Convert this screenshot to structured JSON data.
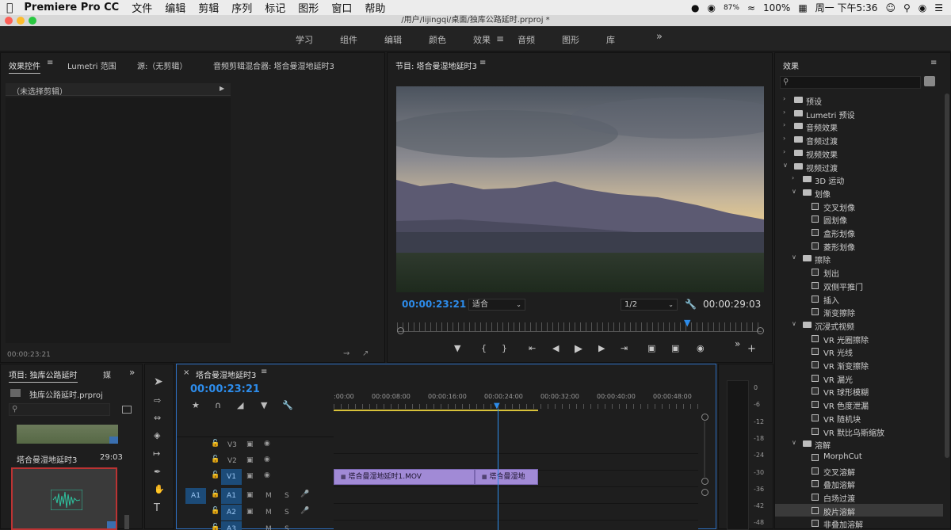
{
  "menubar": {
    "app": "Premiere Pro CC",
    "items": [
      "文件",
      "编辑",
      "剪辑",
      "序列",
      "标记",
      "图形",
      "窗口",
      "帮助"
    ],
    "battery_pct": "87%",
    "wifi_label": "100%",
    "clock": "周一 下午5:36"
  },
  "window": {
    "title": "/用户/lijingqi/桌面/独库公路延时.prproj *"
  },
  "workspaces": {
    "tabs": [
      "学习",
      "组件",
      "编辑",
      "颜色",
      "效果",
      "音频",
      "图形",
      "库"
    ],
    "active": "效果",
    "more": "»"
  },
  "effect_controls": {
    "tabs": [
      "效果控件",
      "Lumetri 范围",
      "源:（无剪辑）",
      "音频剪辑混合器: 塔合曼湿地延时3"
    ],
    "no_clip": "（未选择剪辑）",
    "timecode": "00:00:23:21"
  },
  "program": {
    "title": "节目: 塔合曼湿地延时3",
    "timecode": "00:00:23:21",
    "fit": "适合",
    "quality": "1/2",
    "duration": "00:00:29:03"
  },
  "effects_panel": {
    "title": "效果",
    "items": [
      {
        "label": "预设",
        "level": 0,
        "kind": "folder-star"
      },
      {
        "label": "Lumetri 预设",
        "level": 0,
        "kind": "folder-star"
      },
      {
        "label": "音频效果",
        "level": 0,
        "kind": "folder"
      },
      {
        "label": "音频过渡",
        "level": 0,
        "kind": "folder"
      },
      {
        "label": "视频效果",
        "level": 0,
        "kind": "folder"
      },
      {
        "label": "视频过渡",
        "level": 0,
        "kind": "folder-open"
      },
      {
        "label": "3D 运动",
        "level": 1,
        "kind": "folder"
      },
      {
        "label": "划像",
        "level": 1,
        "kind": "folder-open"
      },
      {
        "label": "交叉划像",
        "level": 2,
        "kind": "fx"
      },
      {
        "label": "圆划像",
        "level": 2,
        "kind": "fx"
      },
      {
        "label": "盒形划像",
        "level": 2,
        "kind": "fx"
      },
      {
        "label": "菱形划像",
        "level": 2,
        "kind": "fx"
      },
      {
        "label": "擦除",
        "level": 1,
        "kind": "folder-open"
      },
      {
        "label": "划出",
        "level": 2,
        "kind": "fx"
      },
      {
        "label": "双侧平推门",
        "level": 2,
        "kind": "fx"
      },
      {
        "label": "插入",
        "level": 2,
        "kind": "fx"
      },
      {
        "label": "渐变擦除",
        "level": 2,
        "kind": "fx"
      },
      {
        "label": "沉浸式视频",
        "level": 1,
        "kind": "folder-open"
      },
      {
        "label": "VR 光圈擦除",
        "level": 2,
        "kind": "fx"
      },
      {
        "label": "VR 光线",
        "level": 2,
        "kind": "fx"
      },
      {
        "label": "VR 渐变擦除",
        "level": 2,
        "kind": "fx"
      },
      {
        "label": "VR 漏光",
        "level": 2,
        "kind": "fx"
      },
      {
        "label": "VR 球形模糊",
        "level": 2,
        "kind": "fx"
      },
      {
        "label": "VR 色度泄漏",
        "level": 2,
        "kind": "fx"
      },
      {
        "label": "VR 随机块",
        "level": 2,
        "kind": "fx"
      },
      {
        "label": "VR 默比乌斯缩放",
        "level": 2,
        "kind": "fx"
      },
      {
        "label": "溶解",
        "level": 1,
        "kind": "folder-open"
      },
      {
        "label": "MorphCut",
        "level": 2,
        "kind": "fx"
      },
      {
        "label": "交叉溶解",
        "level": 2,
        "kind": "fx"
      },
      {
        "label": "叠加溶解",
        "level": 2,
        "kind": "fx"
      },
      {
        "label": "白场过渡",
        "level": 2,
        "kind": "fx"
      },
      {
        "label": "胶片溶解",
        "level": 2,
        "kind": "fx"
      },
      {
        "label": "非叠加溶解",
        "level": 2,
        "kind": "fx"
      }
    ],
    "highlighted": "胶片溶解"
  },
  "project": {
    "title": "项目: 独库公路延时",
    "tab2": "媒",
    "file": "独库公路延时.prproj",
    "item_name": "塔合曼湿地延时3",
    "item_duration": "29:03"
  },
  "timeline": {
    "title": "塔合曼湿地延时3",
    "timecode": "00:00:23:21",
    "ruler": [
      ":00:00",
      "00:00:08:00",
      "00:00:16:00",
      "00:00:24:00",
      "00:00:32:00",
      "00:00:40:00",
      "00:00:48:00"
    ],
    "tracks": [
      "V3",
      "V2",
      "V1",
      "A1",
      "A2",
      "A3"
    ],
    "src_patch": "A1",
    "mute": "M",
    "solo": "S",
    "clip1": "塔合曼湿地延时1.MOV",
    "clip2": "塔合曼湿地"
  },
  "meter": {
    "ticks": [
      "0",
      "-6",
      "-12",
      "-18",
      "-24",
      "-30",
      "-36",
      "-42",
      "-48"
    ]
  }
}
